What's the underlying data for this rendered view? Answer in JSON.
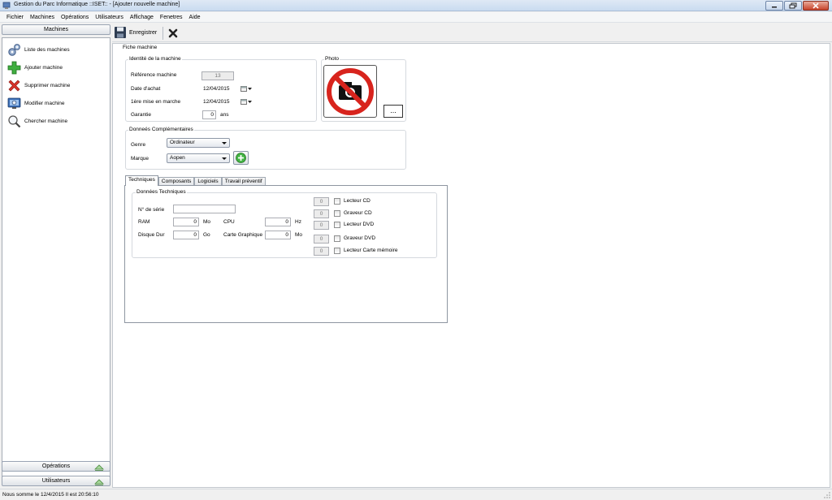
{
  "window": {
    "title": "Gestion du Parc Informatique ::ISET:: - [Ajouter nouvelle machine]"
  },
  "menubar": {
    "items": [
      "Fichier",
      "Machines",
      "Opérations",
      "Utilisateurs",
      "Affichage",
      "Fenetres",
      "Aide"
    ]
  },
  "sidebar": {
    "header": "Machines",
    "items": [
      {
        "label": "Liste des machines",
        "icon": "gears-icon"
      },
      {
        "label": "Ajouter machine",
        "icon": "green-plus-icon"
      },
      {
        "label": "Supprimer machine",
        "icon": "red-x-icon"
      },
      {
        "label": "Modifier machine",
        "icon": "monitor-gear-icon"
      },
      {
        "label": "Chercher machine",
        "icon": "magnifier-icon"
      }
    ],
    "sections": [
      "Opérations",
      "Utilisateurs"
    ]
  },
  "toolbar": {
    "save_label": "Enregistrer"
  },
  "form": {
    "title": "Fiche machine",
    "identity": {
      "title": "Identité de la machine",
      "reference_label": "Référence machine",
      "reference_value": "13",
      "purchase_date_label": "Date d'achat",
      "purchase_date_value": "12/04/2015",
      "first_start_label": "1ère mise en marche",
      "first_start_value": "12/04/2015",
      "warranty_label": "Garantie",
      "warranty_value": "0",
      "warranty_unit": "ans"
    },
    "photo": {
      "title": "Photo",
      "browse_label": "..."
    },
    "complementary": {
      "title": "Donneés Complémentaires",
      "genre_label": "Genre",
      "genre_value": "Ordinateur",
      "brand_label": "Marque",
      "brand_value": "Aopen"
    },
    "tabs": [
      "Techniques",
      "Composants",
      "Logiciels",
      "Travail préventif"
    ],
    "technical": {
      "title": "Données Techniques",
      "serial_label": "N° de série",
      "serial_value": "",
      "ram_label": "RAM",
      "ram_value": "0",
      "ram_unit": "Mo",
      "cpu_label": "CPU",
      "cpu_value": "0",
      "cpu_unit": "Hz",
      "disk_label": "Disque Dur",
      "disk_value": "0",
      "disk_unit": "Go",
      "gpu_label": "Carte Graphique",
      "gpu_value": "0",
      "gpu_unit": "Mo",
      "drives": [
        {
          "count": "0",
          "label": "Lecteur CD",
          "checked": false
        },
        {
          "count": "0",
          "label": "Graveur CD",
          "checked": false
        },
        {
          "count": "0",
          "label": "Lecteur DVD",
          "checked": false
        },
        {
          "count": "0",
          "label": "Graveur DVD",
          "checked": false
        },
        {
          "count": "0",
          "label": "Lecteur Carte mémoire",
          "checked": false
        }
      ]
    }
  },
  "statusbar": {
    "text": "Nous somme le 12/4/2015 Il est 20:56:10"
  }
}
